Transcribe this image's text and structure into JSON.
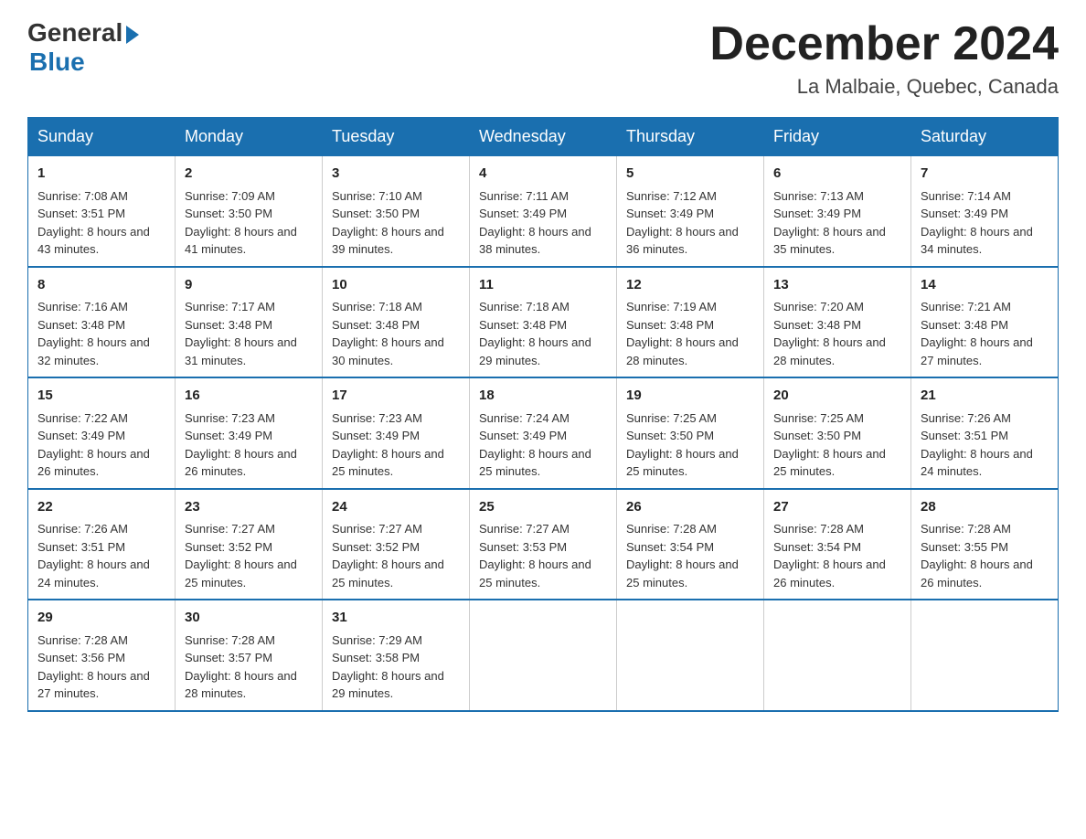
{
  "header": {
    "logo_general": "General",
    "logo_blue": "Blue",
    "month_title": "December 2024",
    "location": "La Malbaie, Quebec, Canada"
  },
  "days_of_week": [
    "Sunday",
    "Monday",
    "Tuesday",
    "Wednesday",
    "Thursday",
    "Friday",
    "Saturday"
  ],
  "weeks": [
    [
      {
        "num": "1",
        "sunrise": "7:08 AM",
        "sunset": "3:51 PM",
        "daylight": "8 hours and 43 minutes."
      },
      {
        "num": "2",
        "sunrise": "7:09 AM",
        "sunset": "3:50 PM",
        "daylight": "8 hours and 41 minutes."
      },
      {
        "num": "3",
        "sunrise": "7:10 AM",
        "sunset": "3:50 PM",
        "daylight": "8 hours and 39 minutes."
      },
      {
        "num": "4",
        "sunrise": "7:11 AM",
        "sunset": "3:49 PM",
        "daylight": "8 hours and 38 minutes."
      },
      {
        "num": "5",
        "sunrise": "7:12 AM",
        "sunset": "3:49 PM",
        "daylight": "8 hours and 36 minutes."
      },
      {
        "num": "6",
        "sunrise": "7:13 AM",
        "sunset": "3:49 PM",
        "daylight": "8 hours and 35 minutes."
      },
      {
        "num": "7",
        "sunrise": "7:14 AM",
        "sunset": "3:49 PM",
        "daylight": "8 hours and 34 minutes."
      }
    ],
    [
      {
        "num": "8",
        "sunrise": "7:16 AM",
        "sunset": "3:48 PM",
        "daylight": "8 hours and 32 minutes."
      },
      {
        "num": "9",
        "sunrise": "7:17 AM",
        "sunset": "3:48 PM",
        "daylight": "8 hours and 31 minutes."
      },
      {
        "num": "10",
        "sunrise": "7:18 AM",
        "sunset": "3:48 PM",
        "daylight": "8 hours and 30 minutes."
      },
      {
        "num": "11",
        "sunrise": "7:18 AM",
        "sunset": "3:48 PM",
        "daylight": "8 hours and 29 minutes."
      },
      {
        "num": "12",
        "sunrise": "7:19 AM",
        "sunset": "3:48 PM",
        "daylight": "8 hours and 28 minutes."
      },
      {
        "num": "13",
        "sunrise": "7:20 AM",
        "sunset": "3:48 PM",
        "daylight": "8 hours and 28 minutes."
      },
      {
        "num": "14",
        "sunrise": "7:21 AM",
        "sunset": "3:48 PM",
        "daylight": "8 hours and 27 minutes."
      }
    ],
    [
      {
        "num": "15",
        "sunrise": "7:22 AM",
        "sunset": "3:49 PM",
        "daylight": "8 hours and 26 minutes."
      },
      {
        "num": "16",
        "sunrise": "7:23 AM",
        "sunset": "3:49 PM",
        "daylight": "8 hours and 26 minutes."
      },
      {
        "num": "17",
        "sunrise": "7:23 AM",
        "sunset": "3:49 PM",
        "daylight": "8 hours and 25 minutes."
      },
      {
        "num": "18",
        "sunrise": "7:24 AM",
        "sunset": "3:49 PM",
        "daylight": "8 hours and 25 minutes."
      },
      {
        "num": "19",
        "sunrise": "7:25 AM",
        "sunset": "3:50 PM",
        "daylight": "8 hours and 25 minutes."
      },
      {
        "num": "20",
        "sunrise": "7:25 AM",
        "sunset": "3:50 PM",
        "daylight": "8 hours and 25 minutes."
      },
      {
        "num": "21",
        "sunrise": "7:26 AM",
        "sunset": "3:51 PM",
        "daylight": "8 hours and 24 minutes."
      }
    ],
    [
      {
        "num": "22",
        "sunrise": "7:26 AM",
        "sunset": "3:51 PM",
        "daylight": "8 hours and 24 minutes."
      },
      {
        "num": "23",
        "sunrise": "7:27 AM",
        "sunset": "3:52 PM",
        "daylight": "8 hours and 25 minutes."
      },
      {
        "num": "24",
        "sunrise": "7:27 AM",
        "sunset": "3:52 PM",
        "daylight": "8 hours and 25 minutes."
      },
      {
        "num": "25",
        "sunrise": "7:27 AM",
        "sunset": "3:53 PM",
        "daylight": "8 hours and 25 minutes."
      },
      {
        "num": "26",
        "sunrise": "7:28 AM",
        "sunset": "3:54 PM",
        "daylight": "8 hours and 25 minutes."
      },
      {
        "num": "27",
        "sunrise": "7:28 AM",
        "sunset": "3:54 PM",
        "daylight": "8 hours and 26 minutes."
      },
      {
        "num": "28",
        "sunrise": "7:28 AM",
        "sunset": "3:55 PM",
        "daylight": "8 hours and 26 minutes."
      }
    ],
    [
      {
        "num": "29",
        "sunrise": "7:28 AM",
        "sunset": "3:56 PM",
        "daylight": "8 hours and 27 minutes."
      },
      {
        "num": "30",
        "sunrise": "7:28 AM",
        "sunset": "3:57 PM",
        "daylight": "8 hours and 28 minutes."
      },
      {
        "num": "31",
        "sunrise": "7:29 AM",
        "sunset": "3:58 PM",
        "daylight": "8 hours and 29 minutes."
      },
      null,
      null,
      null,
      null
    ]
  ],
  "labels": {
    "sunrise_prefix": "Sunrise: ",
    "sunset_prefix": "Sunset: ",
    "daylight_prefix": "Daylight: "
  }
}
